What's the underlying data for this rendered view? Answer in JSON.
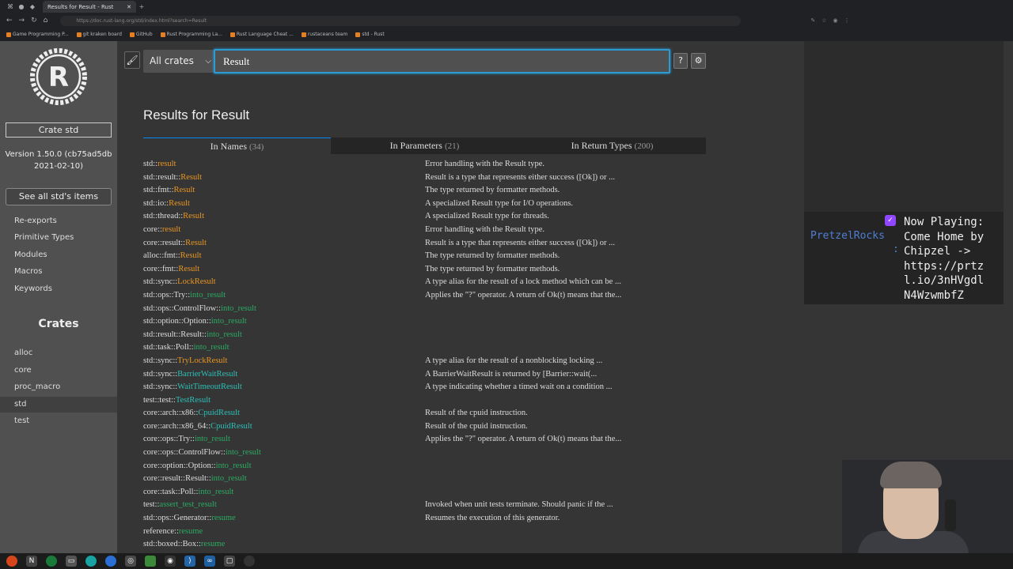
{
  "browser": {
    "tab_title": "Results for Result - Rust",
    "url": "https://doc.rust-lang.org/std/index.html?search=Result",
    "bookmarks": [
      "Game Programming P...",
      "git kraken board",
      "GitHub",
      "Rust Programming La...",
      "Rust Language Cheat ...",
      "rustaceans team",
      "std - Rust"
    ]
  },
  "sidebar": {
    "crate_label": "Crate std",
    "version": "Version 1.50.0 (cb75ad5db",
    "version_date": "2021-02-10)",
    "all_items": "See all std's items",
    "links": [
      "Re-exports",
      "Primitive Types",
      "Modules",
      "Macros",
      "Keywords"
    ],
    "crates_title": "Crates",
    "crates": [
      "alloc",
      "core",
      "proc_macro",
      "std",
      "test"
    ],
    "selected_crate": "std"
  },
  "search": {
    "crate_filter": "All crates",
    "query": "Result",
    "help": "?",
    "brush": "🖌",
    "gear": "⚙"
  },
  "results": {
    "title": "Results for Result",
    "tabs": [
      {
        "label": "In Names",
        "count": "(34)"
      },
      {
        "label": "In Parameters",
        "count": "(21)"
      },
      {
        "label": "In Return Types",
        "count": "(200)"
      }
    ],
    "rows": [
      {
        "path": "std::",
        "item": "result",
        "kind": "md",
        "desc": "Error handling with the Result type."
      },
      {
        "path": "std::result::",
        "item": "Result",
        "kind": "ty",
        "desc": "Result is a type that represents either success ([Ok]) or ..."
      },
      {
        "path": "std::fmt::",
        "item": "Result",
        "kind": "ty",
        "desc": "The type returned by formatter methods."
      },
      {
        "path": "std::io::",
        "item": "Result",
        "kind": "ty",
        "desc": "A specialized Result type for I/O operations."
      },
      {
        "path": "std::thread::",
        "item": "Result",
        "kind": "ty",
        "desc": "A specialized Result type for threads."
      },
      {
        "path": "core::",
        "item": "result",
        "kind": "md",
        "desc": "Error handling with the Result type."
      },
      {
        "path": "core::result::",
        "item": "Result",
        "kind": "ty",
        "desc": "Result is a type that represents either success ([Ok]) or ..."
      },
      {
        "path": "alloc::fmt::",
        "item": "Result",
        "kind": "ty",
        "desc": "The type returned by formatter methods."
      },
      {
        "path": "core::fmt::",
        "item": "Result",
        "kind": "ty",
        "desc": "The type returned by formatter methods."
      },
      {
        "path": "std::sync::",
        "item": "LockResult",
        "kind": "ty",
        "desc": "A type alias for the result of a lock method which can be ..."
      },
      {
        "path": "std::ops::Try::",
        "item": "into_result",
        "kind": "fn",
        "desc": "Applies the \"?\" operator. A return of Ok(t) means that the..."
      },
      {
        "path": "std::ops::ControlFlow::",
        "item": "into_result",
        "kind": "fn",
        "desc": ""
      },
      {
        "path": "std::option::Option::",
        "item": "into_result",
        "kind": "fn",
        "desc": ""
      },
      {
        "path": "std::result::Result::",
        "item": "into_result",
        "kind": "fn",
        "desc": ""
      },
      {
        "path": "std::task::Poll::",
        "item": "into_result",
        "kind": "fn",
        "desc": ""
      },
      {
        "path": "std::sync::",
        "item": "TryLockResult",
        "kind": "ty",
        "desc": "A type alias for the result of a nonblocking locking ..."
      },
      {
        "path": "std::sync::",
        "item": "BarrierWaitResult",
        "kind": "st",
        "desc": "A BarrierWaitResult is returned by [Barrier::wait(..."
      },
      {
        "path": "std::sync::",
        "item": "WaitTimeoutResult",
        "kind": "st",
        "desc": "A type indicating whether a timed wait on a condition ..."
      },
      {
        "path": "test::test::",
        "item": "TestResult",
        "kind": "st",
        "desc": ""
      },
      {
        "path": "core::arch::x86::",
        "item": "CpuidResult",
        "kind": "st",
        "desc": "Result of the cpuid instruction."
      },
      {
        "path": "core::arch::x86_64::",
        "item": "CpuidResult",
        "kind": "st",
        "desc": "Result of the cpuid instruction."
      },
      {
        "path": "core::ops::Try::",
        "item": "into_result",
        "kind": "fn",
        "desc": "Applies the \"?\" operator. A return of Ok(t) means that the..."
      },
      {
        "path": "core::ops::ControlFlow::",
        "item": "into_result",
        "kind": "fn",
        "desc": ""
      },
      {
        "path": "core::option::Option::",
        "item": "into_result",
        "kind": "fn",
        "desc": ""
      },
      {
        "path": "core::result::Result::",
        "item": "into_result",
        "kind": "fn",
        "desc": ""
      },
      {
        "path": "core::task::Poll::",
        "item": "into_result",
        "kind": "fn",
        "desc": ""
      },
      {
        "path": "test::",
        "item": "assert_test_result",
        "kind": "fn",
        "desc": "Invoked when unit tests terminate. Should panic if the ..."
      },
      {
        "path": "std::ops::Generator::",
        "item": "resume",
        "kind": "fn",
        "desc": "Resumes the execution of this generator."
      },
      {
        "path": "reference::",
        "item": "resume",
        "kind": "fn",
        "desc": ""
      },
      {
        "path": "std::boxed::Box::",
        "item": "resume",
        "kind": "fn",
        "desc": ""
      }
    ]
  },
  "overlay": {
    "user": "PretzelRocks",
    "colon": ":",
    "text": "Now Playing:\nCome Home by\nChipzel ->\nhttps://prtz\nl.io/3nHVgdl\nN4WzwmbfZ"
  },
  "colors": {
    "module": "#e89522",
    "type": "#e89522",
    "struct": "#2dbfb8",
    "function": "#2bab63",
    "accent": "#2d9bd3"
  }
}
